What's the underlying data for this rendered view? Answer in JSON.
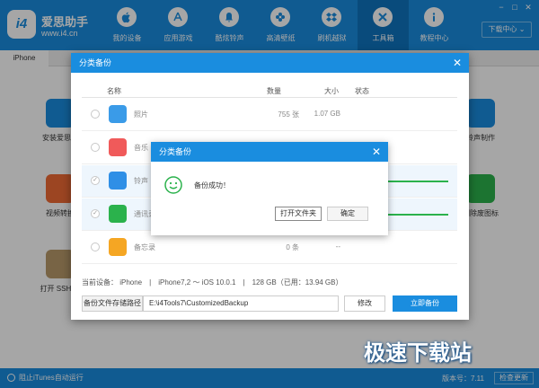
{
  "app": {
    "logo_badge": "i4",
    "name": "爱思助手",
    "url": "www.i4.cn"
  },
  "nav": [
    {
      "label": "我的设备",
      "icon": "apple-icon"
    },
    {
      "label": "应用游戏",
      "icon": "app-store-icon"
    },
    {
      "label": "酷炫铃声",
      "icon": "bell-icon"
    },
    {
      "label": "高清壁纸",
      "icon": "flower-icon"
    },
    {
      "label": "刷机越狱",
      "icon": "dropbox-icon"
    },
    {
      "label": "工具箱",
      "icon": "tools-icon",
      "active": true
    },
    {
      "label": "教程中心",
      "icon": "info-icon"
    }
  ],
  "window_controls": {
    "minimize": "−",
    "maximize": "□",
    "close": "✕"
  },
  "download_center": "下载中心",
  "subtab": "iPhone",
  "tools_left": [
    {
      "label": "安装爱思移",
      "color": "#1a8ddf"
    },
    {
      "label": "视频转换",
      "color": "#f06a35"
    },
    {
      "label": "打开 SSH 通",
      "color": "#b89a6a"
    }
  ],
  "tools_right": [
    {
      "label": "铃声制作",
      "color": "#1a8ddf"
    },
    {
      "label": "删除废图标",
      "color": "#2bb24c"
    }
  ],
  "dialog": {
    "title": "分类备份",
    "headers": {
      "name": "名称",
      "count": "数量",
      "size": "大小",
      "status": "状态"
    },
    "rows": [
      {
        "name": "照片",
        "count": "755 张",
        "size": "1.07 GB",
        "icon_color": "#3a9be8",
        "selected": false,
        "check": "",
        "progress": 0
      },
      {
        "name": "音乐",
        "count": "",
        "size": "",
        "icon_color": "#f05a5a",
        "selected": false,
        "check": "",
        "progress": 0
      },
      {
        "name": "铃声",
        "count": "",
        "size": "",
        "icon_color": "#2f8fe6",
        "selected": true,
        "check": "✓",
        "progress": 1
      },
      {
        "name": "通讯录",
        "count": "",
        "size": "",
        "icon_color": "#2bb24c",
        "selected": true,
        "check": "✓",
        "progress": 1
      },
      {
        "name": "备忘录",
        "count": "0 条",
        "size": "--",
        "icon_color": "#f5a623",
        "selected": false,
        "check": "",
        "progress": 0
      }
    ],
    "device_info": "当前设备： iPhone　|　iPhone7,2 ～ iOS 10.0.1　|　128 GB（已用：13.94 GB）",
    "path_label": "备份文件存储路径",
    "path_value": "E:\\i4Tools7\\CustomizedBackup",
    "modify": "修改",
    "backup_now": "立即备份",
    "close": "✕"
  },
  "success_dialog": {
    "title": "分类备份",
    "message": "备份成功！",
    "open_folder": "打开文件夹",
    "ok": "确定",
    "close": "✕"
  },
  "statusbar": {
    "itunes": "阻止iTunes自动运行",
    "version": "版本号：7.11",
    "check_update": "检查更新"
  },
  "watermark": "极速下载站"
}
